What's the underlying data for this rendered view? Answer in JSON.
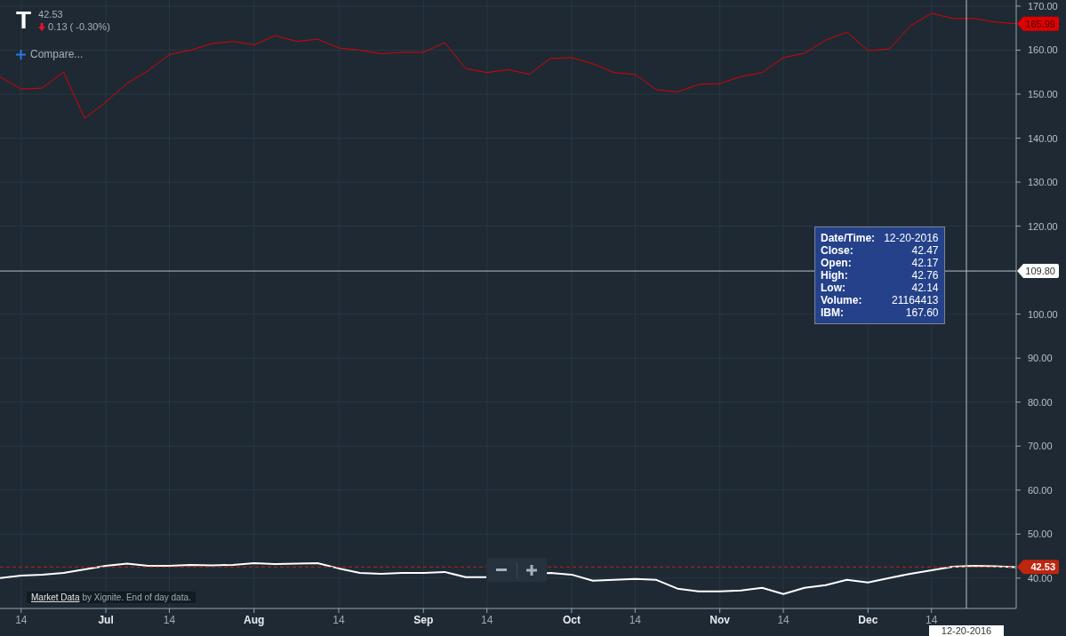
{
  "header": {
    "symbol": "T",
    "price": "42.53",
    "change": "0.13 ( -0.30%)"
  },
  "compare": {
    "label": "Compare..."
  },
  "chart": {
    "chart_data": {
      "type": "line",
      "categories": [
        null,
        "14",
        null,
        null,
        null,
        "Jul",
        null,
        null,
        "14",
        null,
        null,
        null,
        "Aug",
        null,
        null,
        null,
        "14",
        null,
        null,
        null,
        "Sep",
        null,
        null,
        "14",
        null,
        null,
        null,
        "Oct",
        null,
        null,
        "14",
        null,
        null,
        null,
        "Nov",
        null,
        null,
        "14",
        null,
        null,
        null,
        "Dec",
        null,
        null,
        "14",
        null,
        null,
        null,
        null
      ],
      "series": [
        {
          "color": "#ffffff",
          "values": [
            40.0,
            40.6,
            40.8,
            41.2,
            42.0,
            42.8,
            43.3,
            42.8,
            42.8,
            43.0,
            42.9,
            43.0,
            43.4,
            43.2,
            43.3,
            43.4,
            42.2,
            41.2,
            41.0,
            41.2,
            41.2,
            41.4,
            40.2,
            40.2,
            null,
            null,
            41.2,
            40.8,
            39.4,
            39.6,
            39.8,
            39.6,
            37.6,
            37.0,
            37.0,
            37.2,
            37.8,
            36.4,
            37.8,
            38.4,
            39.6,
            39.0,
            40.0,
            41.0,
            41.8,
            42.6,
            42.8,
            42.7,
            42.5
          ]
        },
        {
          "color": "#e00000",
          "values": [
            153.9,
            151.2,
            151.4,
            155.0,
            144.5,
            148.2,
            152.5,
            155.3,
            159.0,
            160.0,
            161.5,
            162.0,
            161.2,
            163.3,
            162.0,
            162.5,
            160.5,
            160.0,
            159.2,
            159.5,
            159.5,
            161.7,
            155.8,
            154.9,
            155.6,
            154.5,
            158.1,
            158.3,
            156.9,
            154.9,
            154.5,
            151.0,
            150.5,
            152.2,
            152.4,
            154.0,
            154.9,
            158.3,
            159.3,
            162.3,
            164.1,
            159.9,
            160.3,
            165.5,
            168.4,
            167.2,
            167.2,
            166.4,
            166.0
          ]
        }
      ],
      "ylim": [
        33.1,
        171.4
      ],
      "grid": true,
      "ref_lines": [
        {
          "axis": "y",
          "value": 42.53,
          "label": "42.53",
          "color": "#c0250f"
        },
        {
          "axis": "y",
          "value": 109.8,
          "label": "109.80",
          "color": "#b8c0c8"
        }
      ],
      "yticks": [
        {
          "value": 40,
          "label": "40.00"
        },
        {
          "value": 50,
          "label": "50.00"
        },
        {
          "value": 60,
          "label": "60.00"
        },
        {
          "value": 70,
          "label": "70.00"
        },
        {
          "value": 80,
          "label": "80.00"
        },
        {
          "value": 90,
          "label": "90.00"
        },
        {
          "value": 100,
          "label": "100.00"
        },
        {
          "value": 120,
          "label": "120.00"
        },
        {
          "value": 130,
          "label": "130.00"
        },
        {
          "value": 140,
          "label": "140.00"
        },
        {
          "value": 150,
          "label": "150.00"
        },
        {
          "value": 160,
          "label": "160.00"
        },
        {
          "value": 170,
          "label": "170.00"
        }
      ]
    },
    "price_tags": [
      {
        "label": "165.99",
        "color": "#e00000"
      }
    ],
    "crosshair": {
      "x_label": "12-20-2016"
    }
  },
  "tooltip": {
    "rows": [
      {
        "label": "Date/Time:",
        "value": "12-20-2016"
      },
      {
        "label": "Close:",
        "value": "42.47"
      },
      {
        "label": "Open:",
        "value": "42.17"
      },
      {
        "label": "High:",
        "value": "42.76"
      },
      {
        "label": "Low:",
        "value": "42.14"
      },
      {
        "label": "Volume:",
        "value": "21164413"
      },
      {
        "label": "IBM:",
        "value": "167.60"
      }
    ]
  },
  "zoom": {
    "buttons": [
      {
        "kind": "zoom_out"
      },
      {
        "kind": "zoom_in"
      }
    ]
  },
  "attribution": {
    "link": "Market Data",
    "text": "by Xignite. End of day data."
  }
}
